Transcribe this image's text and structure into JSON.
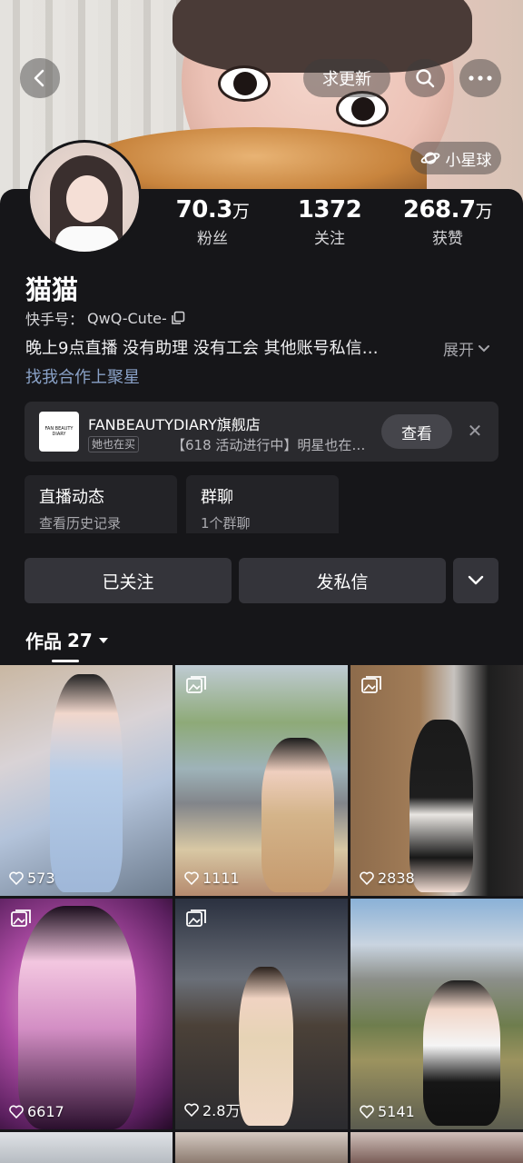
{
  "header": {
    "update_label": "求更新",
    "planet_label": "小星球"
  },
  "profile": {
    "name": "猫猫",
    "kuaishou_id_label": "快手号：",
    "kuaishou_id": "QwQ-Cute-",
    "bio": "晚上9点直播  没有助理 没有工会 其他账号私信…",
    "expand_label": "展开",
    "collab_text": "找我合作上聚星"
  },
  "stats": [
    {
      "value": "70.3",
      "unit": "万",
      "label": "粉丝"
    },
    {
      "value": "1372",
      "unit": "",
      "label": "关注"
    },
    {
      "value": "268.7",
      "unit": "万",
      "label": "获赞"
    }
  ],
  "shop": {
    "logo_text": "FAN BEAUTY DIARY",
    "title": "FANBEAUTYDIARY旗舰店",
    "tag": "她也在买",
    "promo": "【618 活动进行中】明星也在…",
    "view_label": "查看"
  },
  "cards": [
    {
      "title": "直播动态",
      "subtitle": "查看历史记录"
    },
    {
      "title": "群聊",
      "subtitle": "1个群聊"
    }
  ],
  "actions": {
    "followed_label": "已关注",
    "message_label": "发私信"
  },
  "works": {
    "label": "作品",
    "count": "27"
  },
  "grid": [
    {
      "likes": "573",
      "multi": false
    },
    {
      "likes": "1111",
      "multi": true
    },
    {
      "likes": "2838",
      "multi": true
    },
    {
      "likes": "6617",
      "multi": true
    },
    {
      "likes": "2.8万",
      "multi": true
    },
    {
      "likes": "5141",
      "multi": false
    }
  ],
  "colors": {
    "background": "#161619",
    "card": "#2a2a2e",
    "button": "#34343a",
    "link": "#8aa2c8"
  }
}
